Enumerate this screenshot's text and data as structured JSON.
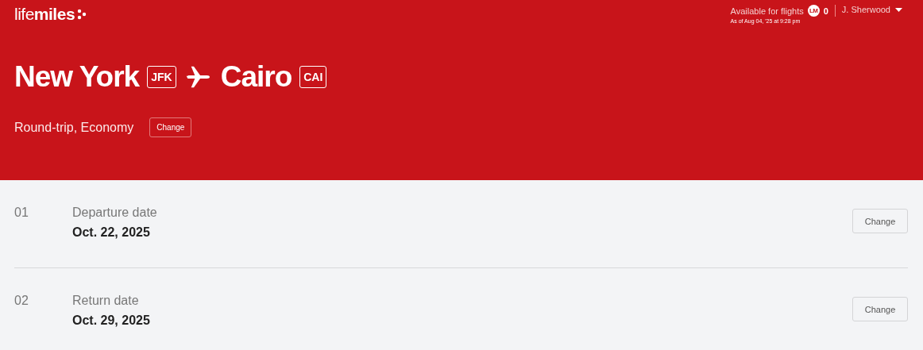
{
  "header": {
    "logo": "life**miles**",
    "balance_label": "Available for flights",
    "miles_badge": "LM",
    "balance": "0",
    "as_of": "As of Aug 04, '25 at 9:28 pm",
    "user": "J. Sherwood"
  },
  "route": {
    "origin": "New York",
    "origin_code": "JFK",
    "destination": "Cairo",
    "destination_code": "CAI",
    "trip": "Round-trip, Economy",
    "change": "Change"
  },
  "steps": [
    {
      "number": "01",
      "label": "Departure date",
      "date": "Oct. 22, 2025",
      "button": "Change"
    },
    {
      "number": "02",
      "label": "Return date",
      "date": "Oct. 29, 2025",
      "button": "Change"
    }
  ]
}
